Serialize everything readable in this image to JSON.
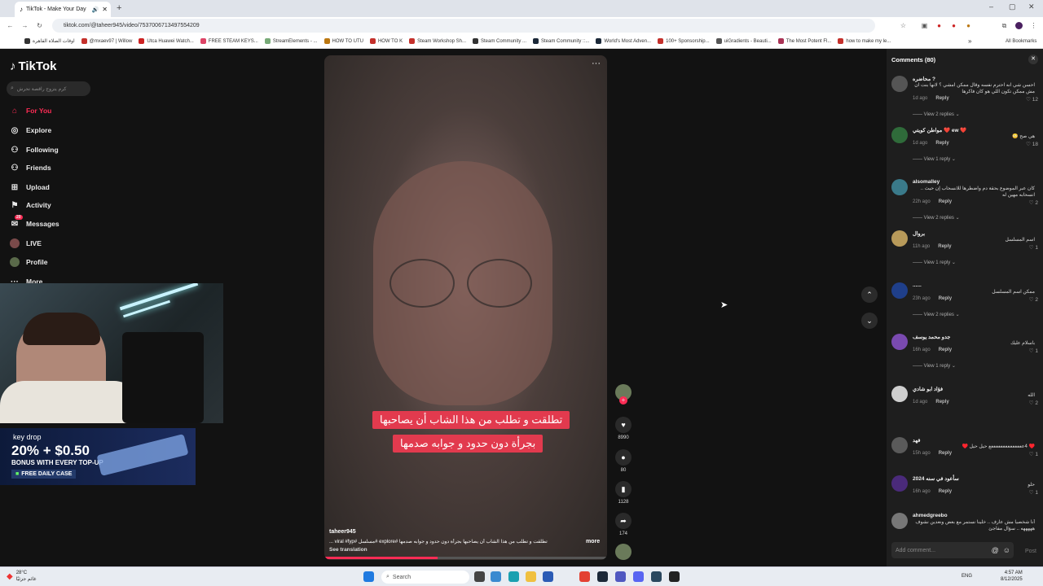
{
  "browser": {
    "tab_title": "TikTok - Make Your Day",
    "url": "tiktok.com/@taheer945/video/7537006713497554209",
    "bookmarks": [
      "اوقات الصلاة القاهرة",
      "@mxaev97 | Willow",
      "Utca Huawei Watch...",
      "FREE STEAM KEYS...",
      "StreamElements - ...",
      "HOW TO UTU",
      "HOW TO K",
      "Steam Workshop Sh...",
      "Steam Community ...",
      "Steam Community ::...",
      "World's Most Adven...",
      "100+ Sponsorship...",
      "uiGradients - Beauti...",
      "The Most Potent Fl...",
      "how to make my le..."
    ],
    "all_bookmarks": "All Bookmarks"
  },
  "sidebar": {
    "logo": "TikTok",
    "search_placeholder": "كرم يتزوج راقصة تحرش",
    "nav": [
      {
        "label": "For You",
        "icon": "home-icon"
      },
      {
        "label": "Explore",
        "icon": "compass-icon"
      },
      {
        "label": "Following",
        "icon": "following-icon"
      },
      {
        "label": "Friends",
        "icon": "friends-icon"
      },
      {
        "label": "Upload",
        "icon": "upload-icon"
      },
      {
        "label": "Activity",
        "icon": "activity-icon"
      },
      {
        "label": "Messages",
        "icon": "messages-icon"
      },
      {
        "label": "LIVE",
        "icon": "live-icon"
      },
      {
        "label": "Profile",
        "icon": "profile-icon"
      },
      {
        "label": "More",
        "icon": "more-icon"
      }
    ],
    "messages_badge": "20"
  },
  "overlay": {
    "keydrop_brand": "key drop",
    "keydrop_line1": "20% + $0.50",
    "keydrop_line2": "BONUS WITH EVERY TOP-UP",
    "keydrop_cta": "FREE DAILY CASE"
  },
  "video": {
    "subtitle_line1": "تطلقت و تطلب من هذا الشاب أن يصاحبها",
    "subtitle_line2": "بجرأة دون حدود و جوابه صدمها",
    "author": "taheer945",
    "caption": "تطلقت و تطلب من هذا الشاب أن يصاحبها بجرأة دون حدود و جوابه صدمها #explore #مسلسل #viral #fyp ...",
    "more": "more",
    "see_translation": "See translation",
    "likes": "8990",
    "comments": "80",
    "saves": "1128",
    "shares": "174"
  },
  "comments_panel": {
    "title": "Comments (80)",
    "add_placeholder": "Add comment...",
    "post": "Post",
    "items": [
      {
        "user": "محاضره ?",
        "text": "احسن شي انه احترم نفسه وقال ممكن امشي ؟ لانها بنت ان مش ممكن تكون اللي هو كان فاكرها",
        "time": "1d ago",
        "reply": "Reply",
        "likes": "12",
        "view_replies": "View 2 replies",
        "av": "#555"
      },
      {
        "user": "مواطن كويتي ❤️ ew ❤️",
        "text": "هي صح 😳",
        "time": "1d ago",
        "reply": "Reply",
        "likes": "18",
        "view_replies": "View 1 reply",
        "av": "#2f6b3a"
      },
      {
        "user": "alsomalley",
        "text": "كان عبر الموضوع بحقة دم واضطرها للانسحاب إن حيث .. انسحابه مهين له",
        "time": "22h ago",
        "reply": "Reply",
        "likes": "2",
        "view_replies": "View 2 replies",
        "av": "#3a7a8a"
      },
      {
        "user": "بروال",
        "text": "اسم المسلسل",
        "time": "11h ago",
        "reply": "Reply",
        "likes": "1",
        "view_replies": "View 1 reply",
        "av": "#b89a5a"
      },
      {
        "user": "......",
        "text": "ممكن اسم المسلسل",
        "time": "23h ago",
        "reply": "Reply",
        "likes": "2",
        "view_replies": "View 2 replies",
        "av": "#1f3f8a"
      },
      {
        "user": "جدو محمد يوسف",
        "text": "باسلام عليك",
        "time": "16h ago",
        "reply": "Reply",
        "likes": "1",
        "view_replies": "View 1 reply",
        "av": "#7a4ab0"
      },
      {
        "user": "فؤاد ابو شادي",
        "text": "الله",
        "time": "1d ago",
        "reply": "Reply",
        "likes": "2",
        "view_replies": "",
        "av": "#cfcfcf"
      },
      {
        "user": "فهد",
        "text": "♥️ 4ععععععععععععععع حيل حيل ♥️",
        "time": "15h ago",
        "reply": "Reply",
        "likes": "1",
        "view_replies": "",
        "av": "#5a5a5a"
      },
      {
        "user": "سأعود في سنه 2024",
        "text": "حلو",
        "time": "16h ago",
        "reply": "Reply",
        "likes": "1",
        "view_replies": "",
        "av": "#4a2a7a"
      },
      {
        "user": "ahmedgreebo",
        "text": "أنا شخصيا مش عارف .. خلينا نستمر مع بعض ونعدين نشوف هههههه .. سؤال مفاجئ",
        "time": "",
        "reply": "",
        "likes": "",
        "view_replies": "",
        "av": "#777"
      }
    ]
  },
  "taskbar": {
    "weather_temp": "28°C",
    "weather_desc": "غائم جزئيًا",
    "search": "Search",
    "lang": "ENG",
    "time": "4:57 AM",
    "date": "8/12/2025"
  }
}
